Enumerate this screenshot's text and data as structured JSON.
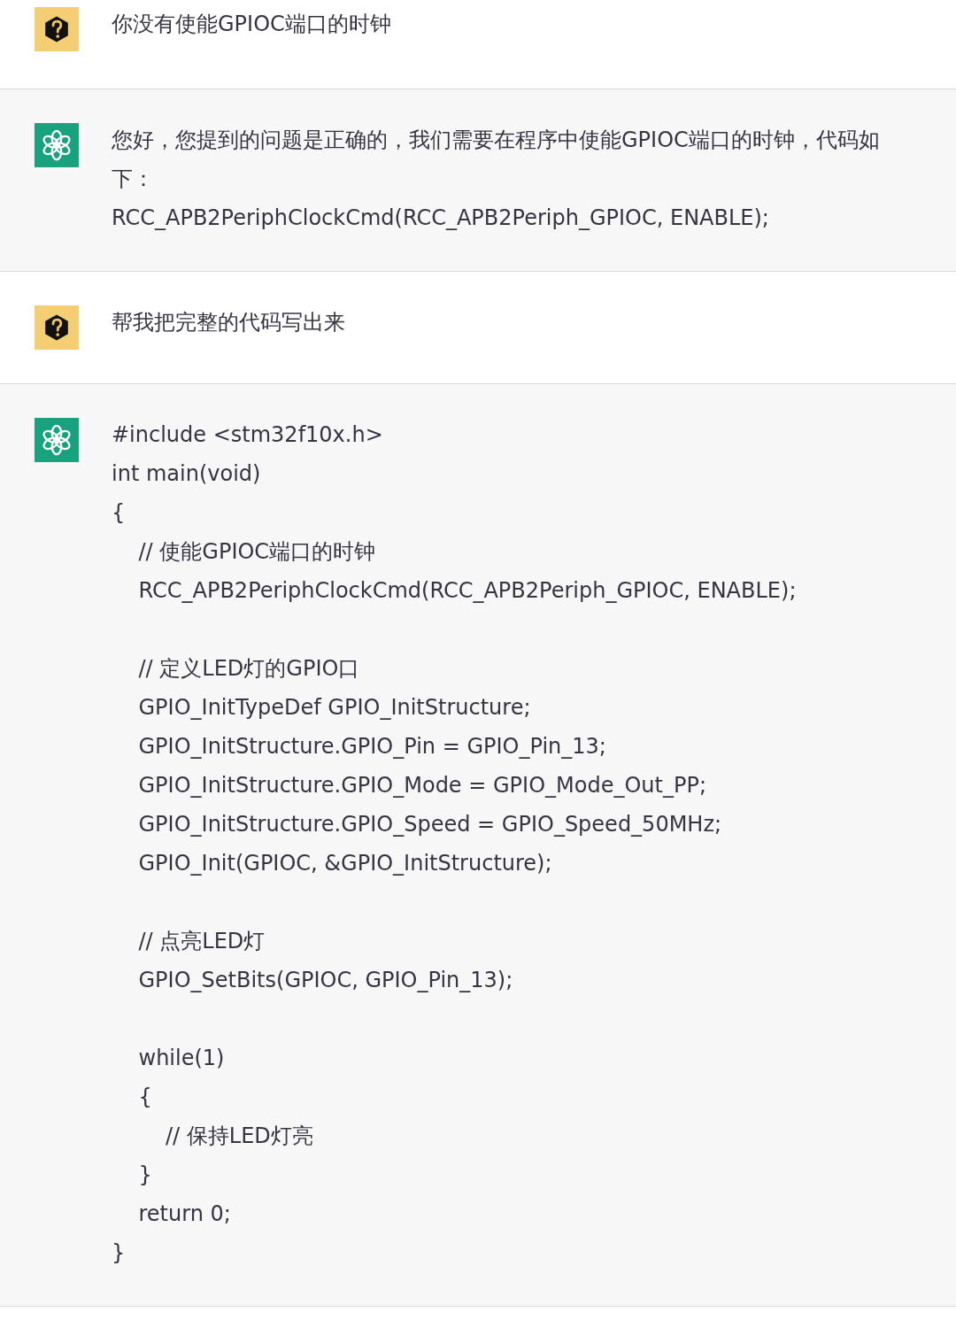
{
  "messages": [
    {
      "kind": "user",
      "blocks": [
        [
          "你没有使能GPIOC端口的时钟"
        ]
      ]
    },
    {
      "kind": "assistant",
      "blocks": [
        [
          "您好，您提到的问题是正确的，我们需要在程序中使能GPIOC端口的时钟，代码如下：",
          "RCC_APB2PeriphClockCmd(RCC_APB2Periph_GPIOC, ENABLE);"
        ]
      ]
    },
    {
      "kind": "user",
      "blocks": [
        [
          "帮我把完整的代码写出来"
        ]
      ]
    },
    {
      "kind": "assistant",
      "blocks": [
        [
          "#include <stm32f10x.h>",
          "int main(void)",
          "{",
          "    // 使能GPIOC端口的时钟",
          "    RCC_APB2PeriphClockCmd(RCC_APB2Periph_GPIOC, ENABLE);"
        ],
        [
          "    // 定义LED灯的GPIO口",
          "    GPIO_InitTypeDef GPIO_InitStructure;",
          "    GPIO_InitStructure.GPIO_Pin = GPIO_Pin_13;",
          "    GPIO_InitStructure.GPIO_Mode = GPIO_Mode_Out_PP;",
          "    GPIO_InitStructure.GPIO_Speed = GPIO_Speed_50MHz;",
          "    GPIO_Init(GPIOC, &GPIO_InitStructure);"
        ],
        [
          "    // 点亮LED灯",
          "    GPIO_SetBits(GPIOC, GPIO_Pin_13);"
        ],
        [
          "    while(1)",
          "    {",
          "        // 保持LED灯亮",
          "    }",
          "    return 0;",
          "}"
        ]
      ]
    }
  ]
}
